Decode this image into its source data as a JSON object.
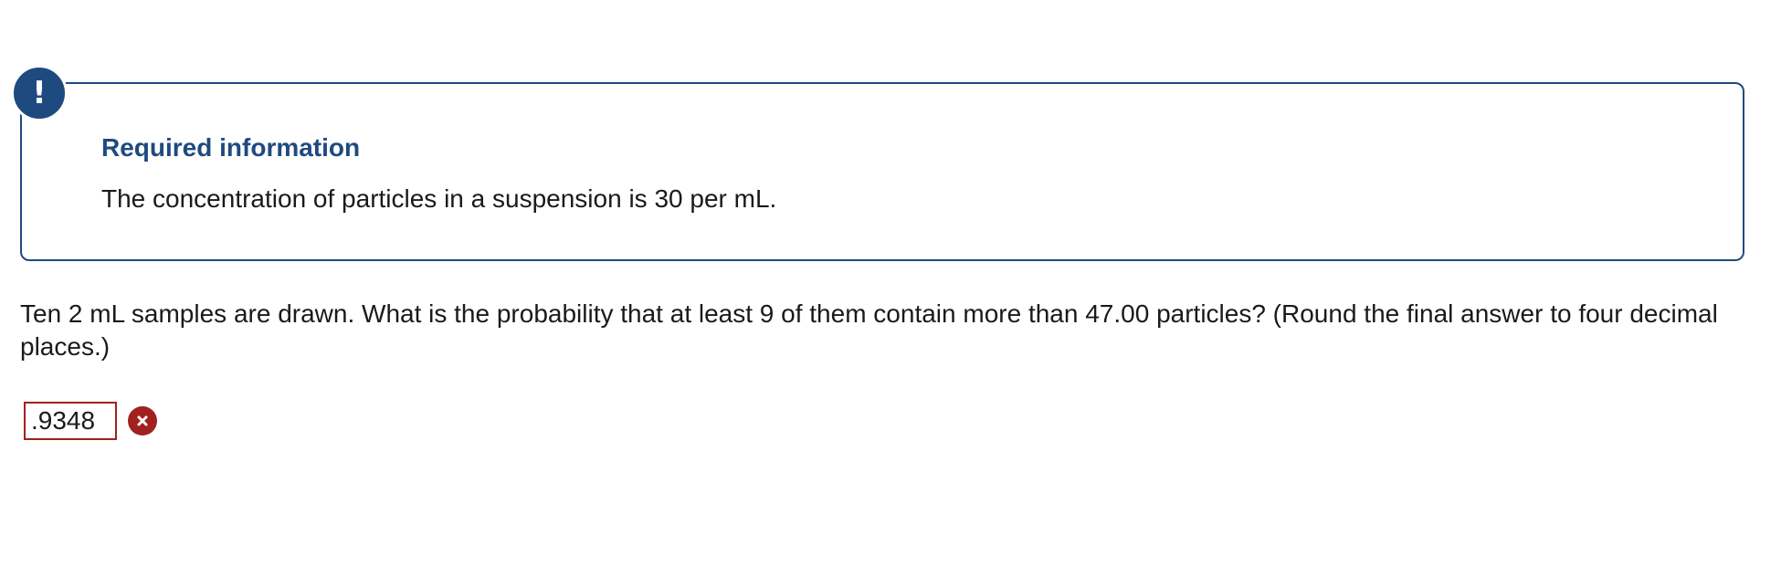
{
  "alert": {
    "badge": "!",
    "title": "Required information",
    "text": "The concentration of particles in a suspension is 30 per mL."
  },
  "question": {
    "text": "Ten 2 mL samples are drawn. What is the probability that at least 9 of them contain more than 47.00 particles? (Round the final answer to four decimal places.)"
  },
  "answer": {
    "value": ".9348",
    "status": "incorrect",
    "status_icon": "x-circle-icon",
    "status_color": "#a32020"
  },
  "colors": {
    "accent": "#1f4a80",
    "error": "#a32020",
    "text": "#1a1a1a"
  }
}
